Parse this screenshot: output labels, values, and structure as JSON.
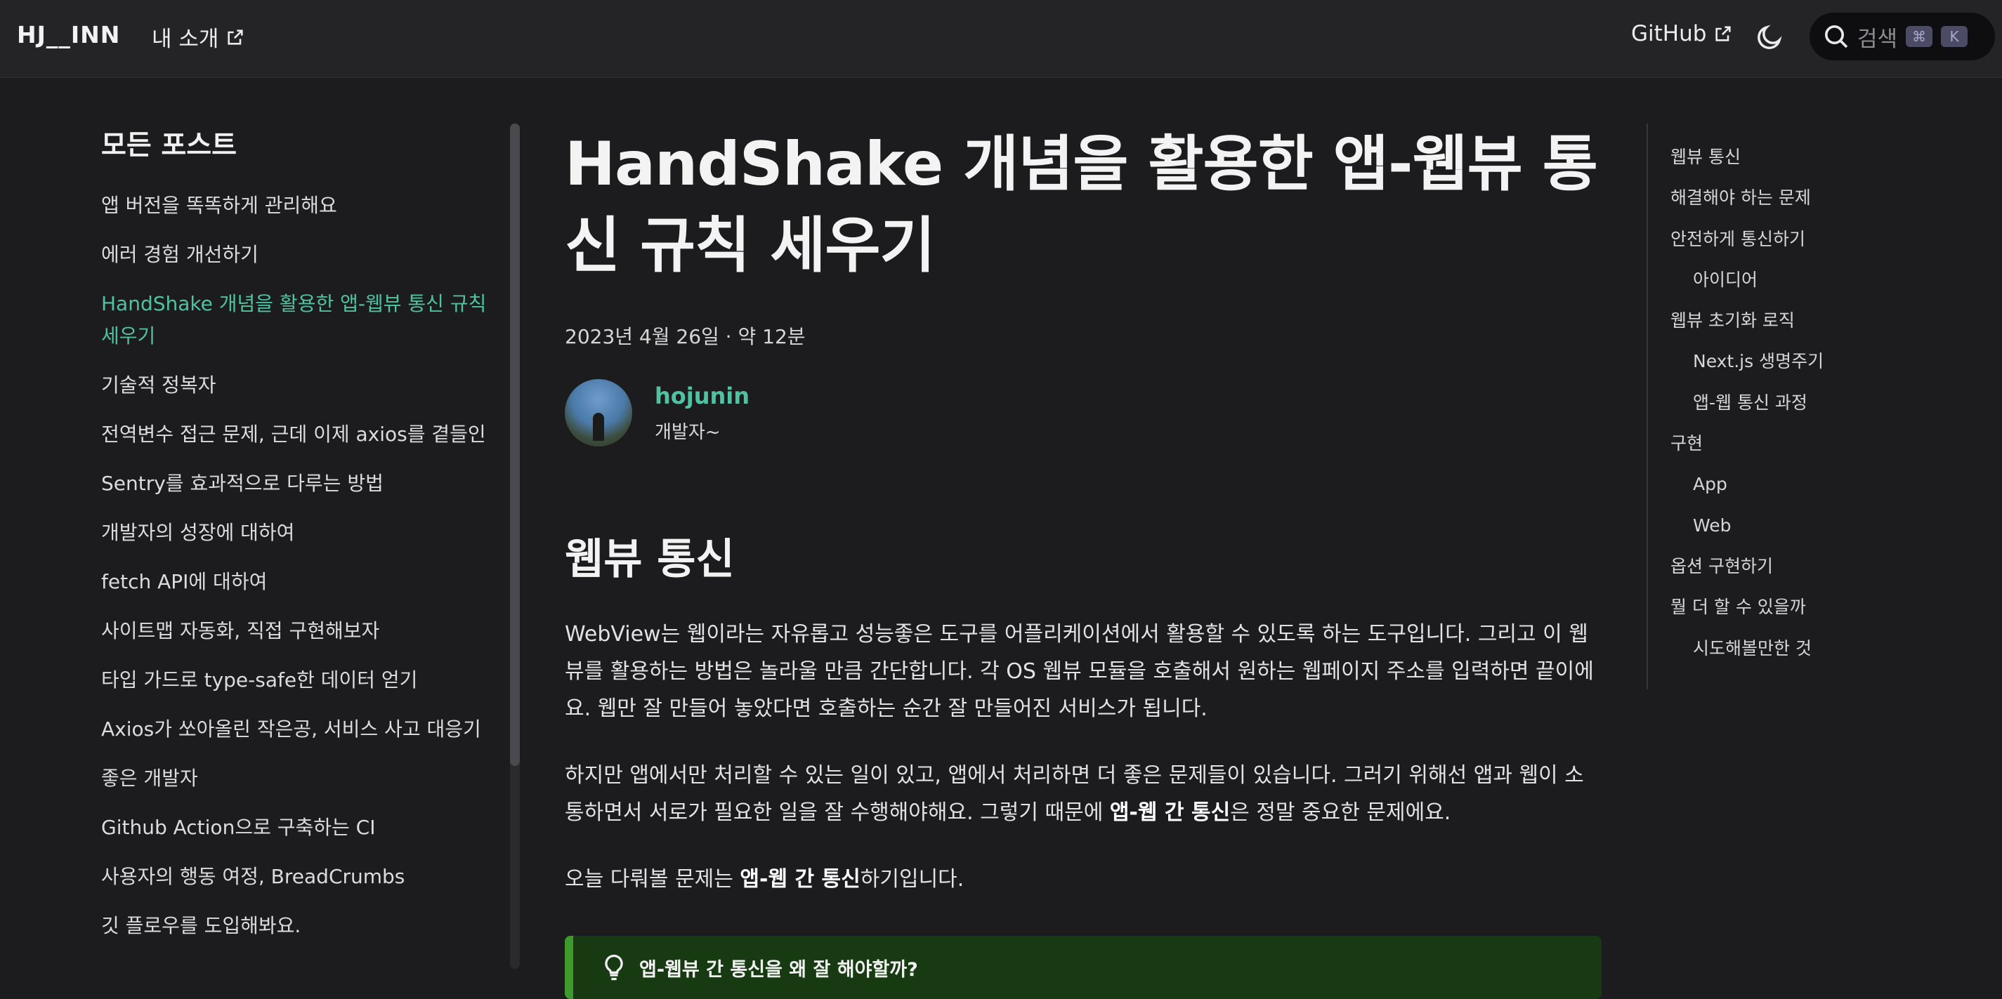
{
  "header": {
    "brand": "HJ__INN",
    "about_label": "내 소개",
    "github_label": "GitHub",
    "search_placeholder": "검색",
    "kbd_cmd": "⌘",
    "kbd_k": "K"
  },
  "sidebar": {
    "title": "모든 포스트",
    "items": [
      {
        "label": "앱 버전을 똑똑하게 관리해요"
      },
      {
        "label": "에러 경험 개선하기"
      },
      {
        "label": "HandShake 개념을 활용한 앱-웹뷰 통신 규칙 세우기"
      },
      {
        "label": "기술적 정복자"
      },
      {
        "label": "전역변수 접근 문제, 근데 이제 axios를 곁들인"
      },
      {
        "label": "Sentry를 효과적으로 다루는 방법"
      },
      {
        "label": "개발자의 성장에 대하여"
      },
      {
        "label": "fetch API에 대하여"
      },
      {
        "label": "사이트맵 자동화, 직접 구현해보자"
      },
      {
        "label": "타입 가드로 type-safe한 데이터 얻기"
      },
      {
        "label": "Axios가 쏘아올린 작은공, 서비스 사고 대응기"
      },
      {
        "label": "좋은 개발자"
      },
      {
        "label": "Github Action으로 구축하는 CI"
      },
      {
        "label": "사용자의 행동 여정, BreadCrumbs"
      },
      {
        "label": "깃 플로우를 도입해봐요."
      }
    ]
  },
  "article": {
    "title": "HandShake 개념을 활용한 앱-웹뷰 통신 규칙 세우기",
    "meta": "2023년 4월 26일 · 약 12분",
    "author_name": "hojunin",
    "author_role": "개발자~",
    "section_heading": "웹뷰 통신",
    "para1": "WebView는 웹이라는 자유롭고 성능좋은 도구를 어플리케이션에서 활용할 수 있도록 하는 도구입니다. 그리고 이 웹뷰를 활용하는 방법은 놀라울 만큼 간단합니다. 각 OS 웹뷰 모듈을 호출해서 원하는 웹페이지 주소를 입력하면 끝이에요. 웹만 잘 만들어 놓았다면 호출하는 순간 잘 만들어진 서비스가 됩니다.",
    "para2_start": "하지만 앱에서만 처리할 수 있는 일이 있고, 앱에서 처리하면 더 좋은 문제들이 있습니다. 그러기 위해선 앱과 웹이 소통하면서 서로가 필요한 일을 잘 수행해야해요. 그렇기 때문에 ",
    "para2_bold": "앱-웹 간 통신",
    "para2_end": "은 정말 중요한 문제에요.",
    "para3_start": "오늘 다뤄볼 문제는 ",
    "para3_bold": "앱-웹 간 통신",
    "para3_end": "하기입니다.",
    "callout": "앱-웹뷰 간 통신을 왜 잘 해야할까?"
  },
  "toc": [
    {
      "label": "웹뷰 통신",
      "level": 1
    },
    {
      "label": "해결해야 하는 문제",
      "level": 1
    },
    {
      "label": "안전하게 통신하기",
      "level": 1
    },
    {
      "label": "아이디어",
      "level": 2
    },
    {
      "label": "웹뷰 초기화 로직",
      "level": 1
    },
    {
      "label": "Next.js 생명주기",
      "level": 2
    },
    {
      "label": "앱-웹 통신 과정",
      "level": 2
    },
    {
      "label": "구현",
      "level": 1
    },
    {
      "label": "App",
      "level": 2
    },
    {
      "label": "Web",
      "level": 2
    },
    {
      "label": "옵션 구현하기",
      "level": 1
    },
    {
      "label": "뭘 더 할 수 있을까",
      "level": 1
    },
    {
      "label": "시도해볼만한 것",
      "level": 2
    }
  ],
  "colors": {
    "accent": "#4fc2a2",
    "background": "#1c1c1e",
    "header_bg": "#242426",
    "callout_bg": "#173a12",
    "callout_border": "#3e9b2b"
  },
  "icons": {
    "external_link": "external-link-icon",
    "theme_toggle": "moon-icon",
    "search": "search-icon",
    "callout": "lightbulb-icon"
  }
}
